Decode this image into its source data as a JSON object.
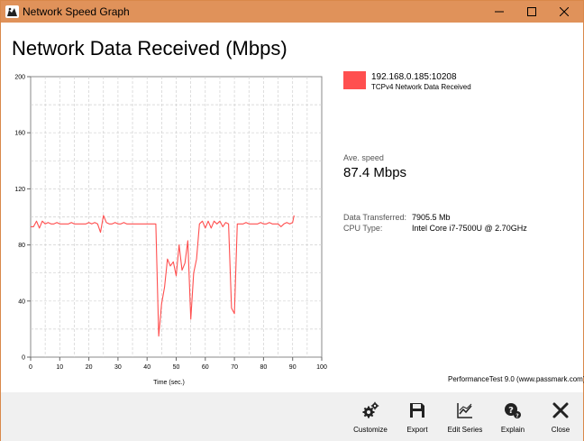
{
  "window": {
    "title": "Network Speed Graph",
    "controls": [
      "minimize",
      "maximize",
      "close"
    ]
  },
  "page": {
    "title": "Network Data Received (Mbps)"
  },
  "legend": {
    "color": "#ff4f4f",
    "series_name": "192.168.0.185:10208",
    "series_detail": "TCPv4 Network Data Received"
  },
  "stats": {
    "ave_speed_label": "Ave. speed",
    "ave_speed_value": "87.4 Mbps",
    "data_transferred_label": "Data Transferred:",
    "data_transferred_value": "7905.5 Mb",
    "cpu_type_label": "CPU Type:",
    "cpu_type_value": "Intel Core i7-7500U @ 2.70GHz"
  },
  "credit": "PerformanceTest 9.0 (www.passmark.com)",
  "toolbar": {
    "buttons": [
      {
        "label": "Customize",
        "icon": "gears-icon"
      },
      {
        "label": "Export",
        "icon": "save-icon"
      },
      {
        "label": "Edit Series",
        "icon": "line-chart-icon"
      },
      {
        "label": "Explain",
        "icon": "help-icon"
      },
      {
        "label": "Close",
        "icon": "close-icon"
      }
    ]
  },
  "chart_data": {
    "type": "line",
    "title": "",
    "xlabel": "Time (sec.)",
    "ylabel": "",
    "xlim": [
      0,
      100
    ],
    "ylim": [
      0,
      200
    ],
    "x_ticks": [
      0,
      10,
      20,
      30,
      40,
      50,
      60,
      70,
      80,
      90,
      100
    ],
    "y_ticks": [
      0,
      40,
      80,
      120,
      160,
      200
    ],
    "grid": true,
    "series": [
      {
        "name": "192.168.0.185:10208",
        "color": "#ff4f4f",
        "x": [
          0,
          1,
          2,
          3,
          4,
          5,
          6,
          7,
          8,
          9,
          10,
          11,
          12,
          13,
          14,
          15,
          16,
          17,
          18,
          19,
          20,
          21,
          22,
          23,
          24,
          25,
          26,
          27,
          28,
          29,
          30,
          31,
          32,
          33,
          34,
          35,
          36,
          37,
          38,
          39,
          40,
          41,
          42,
          43,
          44,
          45,
          46,
          47,
          48,
          49,
          50,
          51,
          52,
          53,
          54,
          55,
          56,
          57,
          58,
          59,
          60,
          61,
          62,
          63,
          64,
          65,
          66,
          67,
          68,
          69,
          70,
          71,
          72,
          73,
          74,
          75,
          76,
          77,
          78,
          79,
          80,
          81,
          82,
          83,
          84,
          85,
          86,
          87,
          88,
          89,
          90,
          90.5
        ],
        "y": [
          93,
          93,
          97,
          92,
          97,
          95,
          96,
          95,
          95,
          96,
          95,
          95,
          95,
          95,
          96,
          95,
          95,
          95,
          95,
          95,
          96,
          95,
          96,
          95,
          89,
          101,
          96,
          95,
          95,
          96,
          95,
          95,
          96,
          95,
          95,
          95,
          95,
          95,
          95,
          95,
          95,
          95,
          95,
          95,
          15,
          38,
          50,
          70,
          65,
          68,
          58,
          80,
          62,
          67,
          83,
          27,
          60,
          70,
          95,
          97,
          92,
          97,
          92,
          97,
          95,
          97,
          93,
          96,
          95,
          35,
          31,
          95,
          95,
          95,
          96,
          95,
          95,
          95,
          95,
          96,
          95,
          95,
          96,
          95,
          95,
          95,
          93,
          95,
          96,
          95,
          96,
          101
        ]
      }
    ]
  }
}
